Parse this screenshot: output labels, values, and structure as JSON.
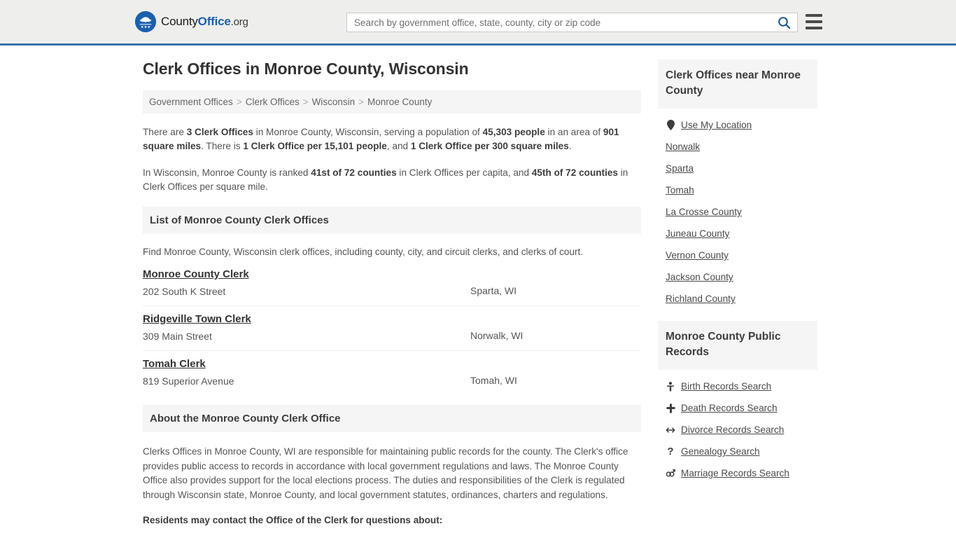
{
  "header": {
    "logo_text_1": "County",
    "logo_text_2": "Office",
    "logo_text_3": ".org",
    "logo_icon": "eagle-seal-icon",
    "search_placeholder": "Search by government office, state, county, city or zip code",
    "search_value": "",
    "search_icon": "search-icon",
    "menu_icon": "hamburger-menu-icon"
  },
  "main": {
    "page_title": "Clerk Offices in Monroe County, Wisconsin",
    "breadcrumb": [
      "Government Offices",
      "Clerk Offices",
      "Wisconsin",
      "Monroe County"
    ],
    "breadcrumb_separator": ">",
    "intro_paragraph_1": {
      "p1": "There are ",
      "b1": "3 Clerk Offices",
      "p2": " in Monroe County, Wisconsin, serving a population of ",
      "b2": "45,303 people",
      "p3": " in an area of ",
      "b3": "901 square miles",
      "p4": ". There is ",
      "b4": "1 Clerk Office per 15,101 people",
      "p5": ", and ",
      "b5": "1 Clerk Office per 300 square miles",
      "p6": "."
    },
    "intro_paragraph_2": {
      "p1": "In Wisconsin, Monroe County is ranked ",
      "b1": "41st of 72 counties",
      "p2": " in Clerk Offices per capita, and ",
      "b2": "45th of 72 counties",
      "p3": " in Clerk Offices per square mile."
    },
    "list_section_title": "List of Monroe County Clerk Offices",
    "list_section_desc": "Find Monroe County, Wisconsin clerk offices, including county, city, and circuit clerks, and clerks of court.",
    "offices": [
      {
        "name": "Monroe County Clerk",
        "address": "202 South K Street",
        "city": "Sparta, WI"
      },
      {
        "name": "Ridgeville Town Clerk",
        "address": "309 Main Street",
        "city": "Norwalk, WI"
      },
      {
        "name": "Tomah Clerk",
        "address": "819 Superior Avenue",
        "city": "Tomah, WI"
      }
    ],
    "about_section_title": "About the Monroe County Clerk Office",
    "about_paragraph": "Clerks Offices in Monroe County, WI are responsible for maintaining public records for the county. The Clerk's office provides public access to records in accordance with local government regulations and laws. The Monroe County Office also provides support for the local elections process. The duties and responsibilities of the Clerk is regulated through Wisconsin state, Monroe County, and local government statutes, ordinances, charters and regulations.",
    "about_subheading": "Residents may contact the Office of the Clerk for questions about:"
  },
  "sidebar": {
    "nearby": {
      "title": "Clerk Offices near Monroe County",
      "items": [
        {
          "label": "Use My Location",
          "icon": "map-pin-icon",
          "glyph": "•"
        },
        {
          "label": "Norwalk",
          "icon": "",
          "glyph": ""
        },
        {
          "label": "Sparta",
          "icon": "",
          "glyph": ""
        },
        {
          "label": "Tomah",
          "icon": "",
          "glyph": ""
        },
        {
          "label": "La Crosse County",
          "icon": "",
          "glyph": ""
        },
        {
          "label": "Juneau County",
          "icon": "",
          "glyph": ""
        },
        {
          "label": "Vernon County",
          "icon": "",
          "glyph": ""
        },
        {
          "label": "Jackson County",
          "icon": "",
          "glyph": ""
        },
        {
          "label": "Richland County",
          "icon": "",
          "glyph": ""
        }
      ]
    },
    "records": {
      "title": "Monroe County Public Records",
      "items": [
        {
          "label": "Birth Records Search",
          "icon": "baby-icon",
          "glyph": "Ɣ"
        },
        {
          "label": "Death Records Search",
          "icon": "cross-icon",
          "glyph": "✚"
        },
        {
          "label": "Divorce Records Search",
          "icon": "split-arrows-icon",
          "glyph": "↔"
        },
        {
          "label": "Genealogy Search",
          "icon": "question-icon",
          "glyph": "?"
        },
        {
          "label": "Marriage Records Search",
          "icon": "gender-rings-icon",
          "glyph": "⚥"
        }
      ]
    }
  },
  "colors": {
    "header_bg": "#eeeeec",
    "header_border": "#3a72a8",
    "brand_blue": "#1b5fad",
    "panel_bg": "#f5f5f5",
    "text": "#555555",
    "heading": "#3d3d3d"
  }
}
